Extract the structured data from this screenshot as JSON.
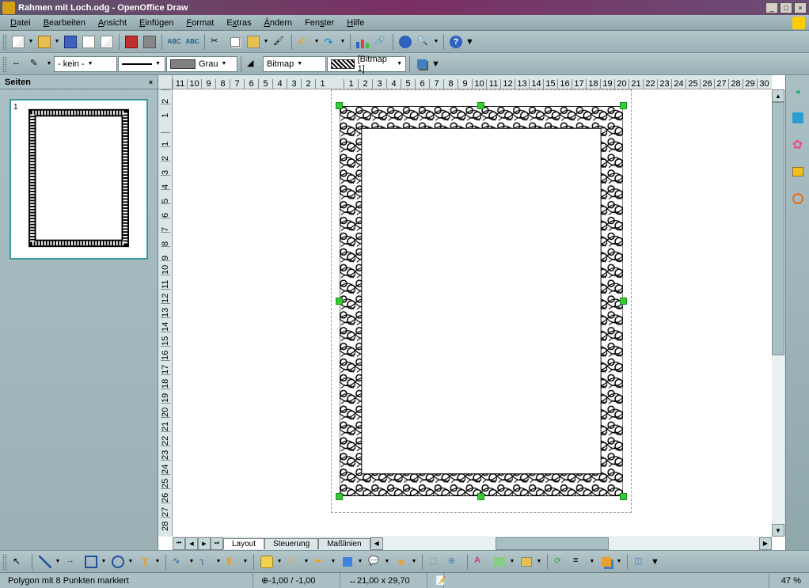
{
  "title": "Rahmen mit Loch.odg - OpenOffice Draw",
  "menu": {
    "datei": "Datei",
    "bearbeiten": "Bearbeiten",
    "ansicht": "Ansicht",
    "einfuegen": "Einfügen",
    "format": "Format",
    "extras": "Extras",
    "aendern": "Ändern",
    "fenster": "Fenster",
    "hilfe": "Hilfe"
  },
  "toolbar2": {
    "linestyle": "- kein -",
    "areacolor": "Grau",
    "fillstyle": "Bitmap",
    "bitmapname": "[Bitmap 1]"
  },
  "sidebar": {
    "title": "Seiten",
    "page_num": "1"
  },
  "ruler_h": [
    "11",
    "10",
    "9",
    "8",
    "7",
    "6",
    "5",
    "4",
    "3",
    "2",
    "1",
    "",
    "1",
    "2",
    "3",
    "4",
    "5",
    "6",
    "7",
    "8",
    "9",
    "10",
    "11",
    "12",
    "13",
    "14",
    "15",
    "16",
    "17",
    "18",
    "19",
    "20",
    "21",
    "22",
    "23",
    "24",
    "25",
    "26",
    "27",
    "28",
    "29",
    "30"
  ],
  "ruler_v": [
    "2",
    "1",
    "",
    "1",
    "2",
    "3",
    "4",
    "5",
    "6",
    "7",
    "8",
    "9",
    "10",
    "11",
    "12",
    "13",
    "14",
    "15",
    "16",
    "17",
    "18",
    "19",
    "20",
    "21",
    "22",
    "23",
    "24",
    "25",
    "26",
    "27",
    "28"
  ],
  "tabs": {
    "layout": "Layout",
    "steuerung": "Steuerung",
    "masslinien": "Maßlinien"
  },
  "status": {
    "selection": "Polygon mit 8 Punkten markiert",
    "pos": "-1,00 / -1,00",
    "size": "21,00 x 29,70",
    "zoom": "47 %"
  }
}
